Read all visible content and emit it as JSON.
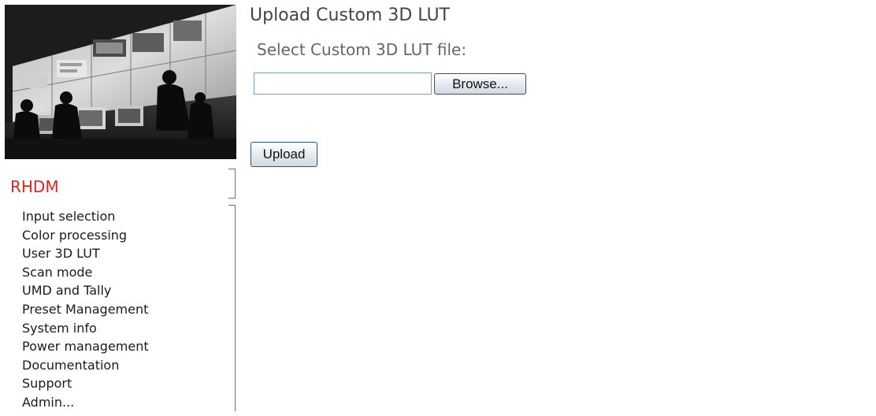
{
  "sidebar": {
    "brand": "RHDM",
    "items": [
      {
        "label": "Input selection"
      },
      {
        "label": "Color processing"
      },
      {
        "label": "User 3D LUT"
      },
      {
        "label": "Scan mode"
      },
      {
        "label": "UMD and Tally"
      },
      {
        "label": "Preset Management"
      },
      {
        "label": "System info"
      },
      {
        "label": "Power management"
      },
      {
        "label": "Documentation"
      },
      {
        "label": "Support"
      },
      {
        "label": "Admin..."
      }
    ]
  },
  "main": {
    "title": "Upload Custom 3D LUT",
    "file_label": "Select Custom 3D LUT file:",
    "file_value": "",
    "browse_label": "Browse...",
    "upload_label": "Upload"
  },
  "colors": {
    "brand": "#e8231e",
    "title": "#444444",
    "label": "#666666",
    "input_border": "#7a9cc6"
  }
}
